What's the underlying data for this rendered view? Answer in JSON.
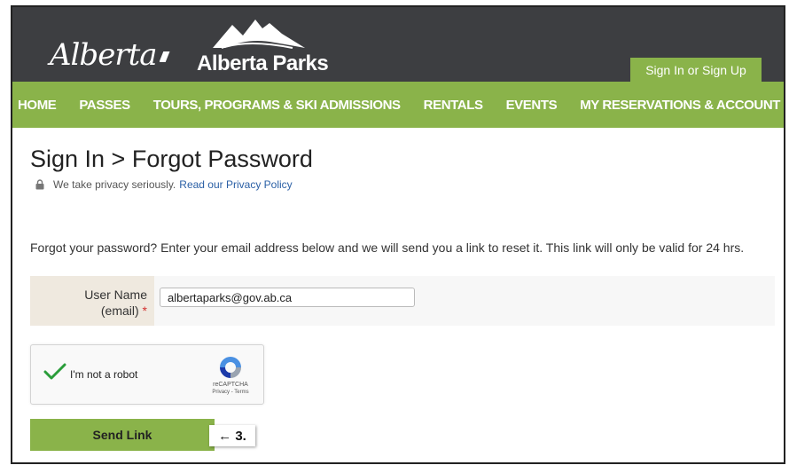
{
  "header": {
    "alberta_logo_text": "Alberta",
    "parks_logo_text": "Alberta Parks",
    "signin_label": "Sign In or Sign Up"
  },
  "nav": {
    "items": [
      {
        "label": "HOME"
      },
      {
        "label": "PASSES"
      },
      {
        "label": "TOURS, PROGRAMS & SKI ADMISSIONS"
      },
      {
        "label": "RENTALS"
      },
      {
        "label": "EVENTS"
      },
      {
        "label": "MY RESERVATIONS & ACCOUNT"
      }
    ]
  },
  "main": {
    "title": "Sign In > Forgot Password",
    "privacy_text": "We take privacy seriously.",
    "privacy_link": "Read our Privacy Policy",
    "instructions": "Forgot your password? Enter your email address below and we will send you a link to reset it. This link will only be valid for 24 hrs.",
    "form": {
      "username_label_line1": "User Name",
      "username_label_line2": "(email)",
      "required_marker": "*",
      "username_value": "albertaparks@gov.ab.ca"
    },
    "captcha": {
      "label": "I'm not a robot",
      "brand": "reCAPTCHA",
      "terms": "Privacy - Terms"
    },
    "send_button_label": "Send Link",
    "callout_label": "← 3."
  },
  "colors": {
    "header_bg": "#3d3e41",
    "accent_green": "#8ab34a",
    "link_blue": "#2a5fa5",
    "required_red": "#d32f2f"
  },
  "icons": [
    "alberta-logo",
    "mountain-icon",
    "lock-icon",
    "check-icon",
    "recaptcha-icon",
    "arrow-left-icon"
  ]
}
